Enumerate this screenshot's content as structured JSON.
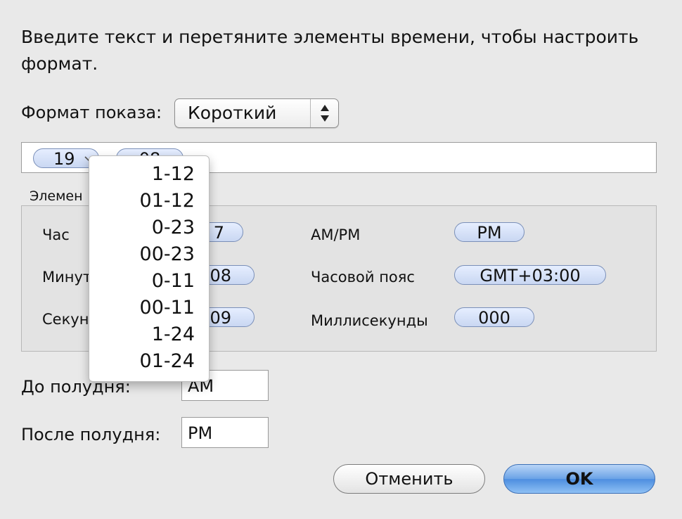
{
  "instruction": "Введите текст и перетяните элементы времени, чтобы настроить формат.",
  "display_format": {
    "label": "Формат показа:",
    "selected": "Короткий"
  },
  "format_tokens": [
    "19",
    "08"
  ],
  "elements_group": {
    "label": "Элемен",
    "rows": [
      {
        "label": "Час",
        "value": "7"
      },
      {
        "label": "Минут",
        "value": "08"
      },
      {
        "label": "Секун",
        "value": "09"
      }
    ],
    "rows_right": [
      {
        "label": "AM/PM",
        "value": "PM"
      },
      {
        "label": "Часовой пояс",
        "value": "GMT+03:00"
      },
      {
        "label": "Миллисекунды",
        "value": "000"
      }
    ]
  },
  "hour_menu": {
    "options": [
      "1-12",
      "01-12",
      "0-23",
      "00-23",
      "0-11",
      "00-11",
      "1-24",
      "01-24"
    ]
  },
  "am": {
    "label": "До полудня:",
    "value": "AM"
  },
  "pm": {
    "label": "После полудня:",
    "value": "PM"
  },
  "buttons": {
    "cancel": "Отменить",
    "ok": "OK"
  }
}
